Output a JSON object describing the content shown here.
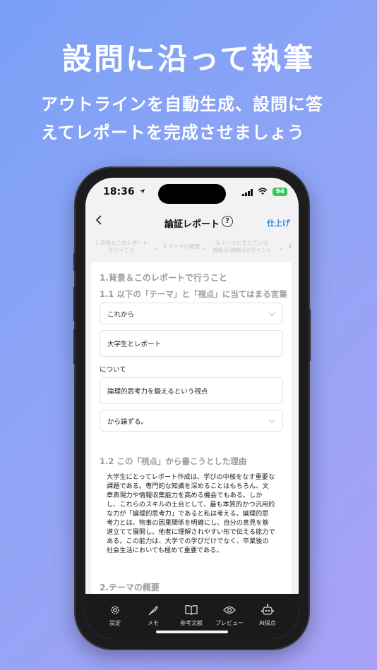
{
  "promo": {
    "headline": "設問に沿って執筆",
    "sub_line1": "アウトラインを自動生成、設問に答",
    "sub_line2": "えてレポートを完成させましょう"
  },
  "status_bar": {
    "time": "18:36",
    "battery": "94"
  },
  "nav": {
    "back_icon": "chevron-left-icon",
    "title": "論証レポート",
    "help_label": "?",
    "finish_label": "仕上げ"
  },
  "steps": [
    {
      "label": "1.背景＆このレポート\nで行うこと"
    },
    {
      "label": "2.テーマの概要"
    },
    {
      "label": "3.テーマに生じている\n問題点(論拠点)/ポイント"
    },
    {
      "label": "4."
    }
  ],
  "form": {
    "section1_title": "1.背景＆このレポートで行うこと",
    "q11_title": "1.1 以下の「テーマ」と「視点」に当てはまる言葉",
    "select1_value": "これから",
    "input1_value": "大学生とレポート",
    "about_label": "について",
    "input2_value": "論理的思考力を鍛えるという視点",
    "select2_value": "から論ずる。",
    "q12_title": "1.2 この「視点」から書こうとした理由",
    "answer_lines": [
      "大学生にとってレポート作成は、学びの中核をなす重要な",
      "課題である。専門的な知識を深めることはもちろん、文",
      "章表現力や情報収集能力を高める機会でもある。しか",
      "し、これらのスキルの土台として、最も本質的かつ汎用的",
      "な力が「論理的思考力」であると私は考える。論理的思",
      "考力とは、物事の因果関係を明確にし、自分の意見を筋",
      "道立てて展開し、他者に理解されやすい形で伝える能力で",
      "ある。この能力は、大学での学びだけでなく、卒業後の",
      "社会生活においても極めて重要である。"
    ],
    "section2_title": "2.テーマの概要"
  },
  "tabs": [
    {
      "label": "設定",
      "icon": "gear-icon"
    },
    {
      "label": "メモ",
      "icon": "feather-icon"
    },
    {
      "label": "参考文献",
      "icon": "book-icon"
    },
    {
      "label": "プレビュー",
      "icon": "eye-icon"
    },
    {
      "label": "AI採点",
      "icon": "robot-icon"
    }
  ],
  "colors": {
    "accent": "#2e8be8",
    "tabbar": "#1a1a1c",
    "battery": "#34c759"
  }
}
